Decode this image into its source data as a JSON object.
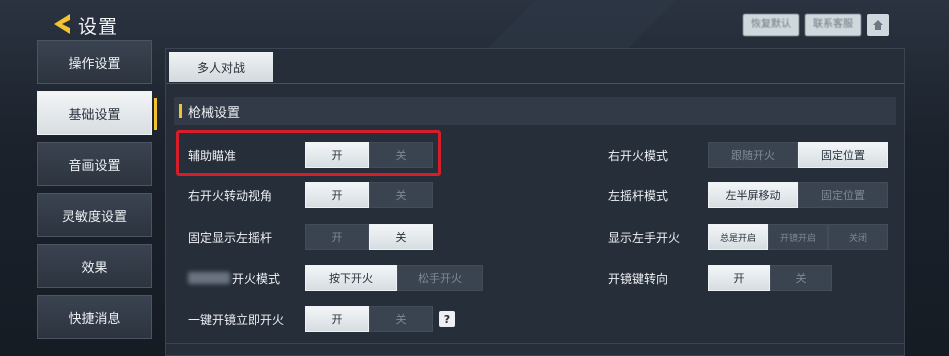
{
  "header": {
    "title": "设置",
    "buttons": [
      "恢复默认",
      "联系客服"
    ]
  },
  "sidebar": {
    "items": [
      {
        "label": "操作设置",
        "active": false
      },
      {
        "label": "基础设置",
        "active": true
      },
      {
        "label": "音画设置",
        "active": false
      },
      {
        "label": "灵敏度设置",
        "active": false
      },
      {
        "label": "效果",
        "active": false
      },
      {
        "label": "快捷消息",
        "active": false
      }
    ]
  },
  "tabs": [
    {
      "label": "多人对战",
      "active": true
    }
  ],
  "section": {
    "title": "枪械设置"
  },
  "left_settings": [
    {
      "label": "辅助瞄准",
      "options": [
        "开",
        "关"
      ],
      "selected": 0
    },
    {
      "label": "右开火转动视角",
      "options": [
        "开",
        "关"
      ],
      "selected": 0
    },
    {
      "label": "固定显示左摇杆",
      "options": [
        "开",
        "关"
      ],
      "selected": 1
    },
    {
      "label": "开火模式",
      "options": [
        "按下开火",
        "松手开火"
      ],
      "selected": 0
    },
    {
      "label": "一键开镜立即开火",
      "options": [
        "开",
        "关"
      ],
      "selected": 0,
      "help": "?"
    }
  ],
  "right_settings": [
    {
      "label": "右开火模式",
      "options": [
        "跟随开火",
        "固定位置"
      ],
      "selected": 1
    },
    {
      "label": "左摇杆模式",
      "options": [
        "左半屏移动",
        "固定位置"
      ],
      "selected": 0
    },
    {
      "label": "显示左手开火",
      "options": [
        "总是开启",
        "开镜开启",
        "关闭"
      ],
      "selected": 0
    },
    {
      "label": "开镜键转向",
      "options": [
        "开",
        "关"
      ],
      "selected": 0
    }
  ],
  "colors": {
    "accent": "#f2c230",
    "highlight": "#d61d2a",
    "panel": "#262e39"
  }
}
